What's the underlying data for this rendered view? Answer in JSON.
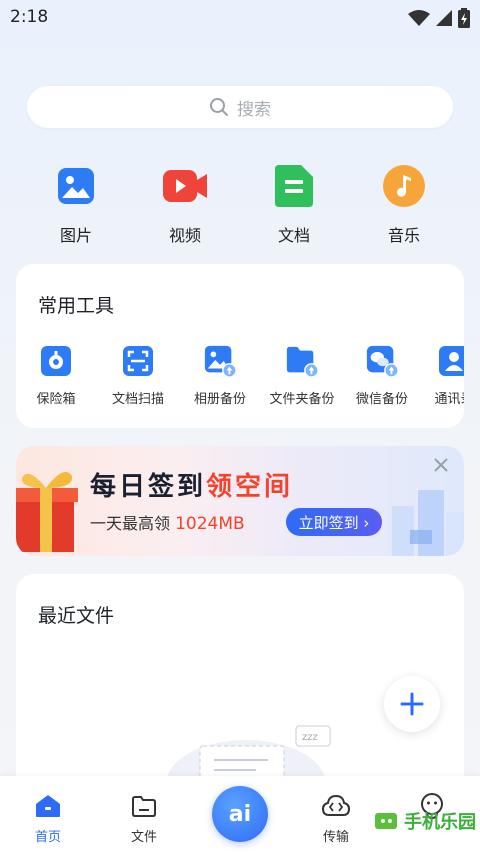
{
  "status_bar": {
    "time": "2:18"
  },
  "search": {
    "placeholder": "搜索"
  },
  "categories": [
    {
      "label": "图片",
      "icon": "image-icon",
      "color": "#2d7cf6"
    },
    {
      "label": "视频",
      "icon": "video-icon",
      "color": "#f0443a"
    },
    {
      "label": "文档",
      "icon": "document-icon",
      "color": "#2fbf5b"
    },
    {
      "label": "音乐",
      "icon": "music-icon",
      "color": "#f7a53a"
    }
  ],
  "tools": {
    "title": "常用工具",
    "items": [
      {
        "label": "保险箱",
        "icon": "safe-icon"
      },
      {
        "label": "文档扫描",
        "icon": "scan-icon"
      },
      {
        "label": "相册备份",
        "icon": "album-backup-icon"
      },
      {
        "label": "文件夹备份",
        "icon": "folder-backup-icon"
      },
      {
        "label": "微信备份",
        "icon": "wechat-backup-icon"
      },
      {
        "label": "通讯录",
        "icon": "contacts-icon"
      }
    ],
    "accent": "#2d7cf6"
  },
  "banner": {
    "title_main": "每日签到",
    "title_accent": "领空间",
    "subtitle": "一天最高领",
    "size": "1024MB",
    "button": "立即签到 ›"
  },
  "recent": {
    "title": "最近文件"
  },
  "bottom_nav": {
    "items": [
      {
        "label": "首页",
        "icon": "home-icon",
        "active": true
      },
      {
        "label": "文件",
        "icon": "folder-icon",
        "active": false
      },
      {
        "label": "传输",
        "icon": "transfer-icon",
        "active": false
      },
      {
        "label": "",
        "icon": "profile-icon",
        "active": false
      }
    ],
    "ai_label": "ai"
  },
  "watermark": {
    "text": "手机乐园"
  }
}
